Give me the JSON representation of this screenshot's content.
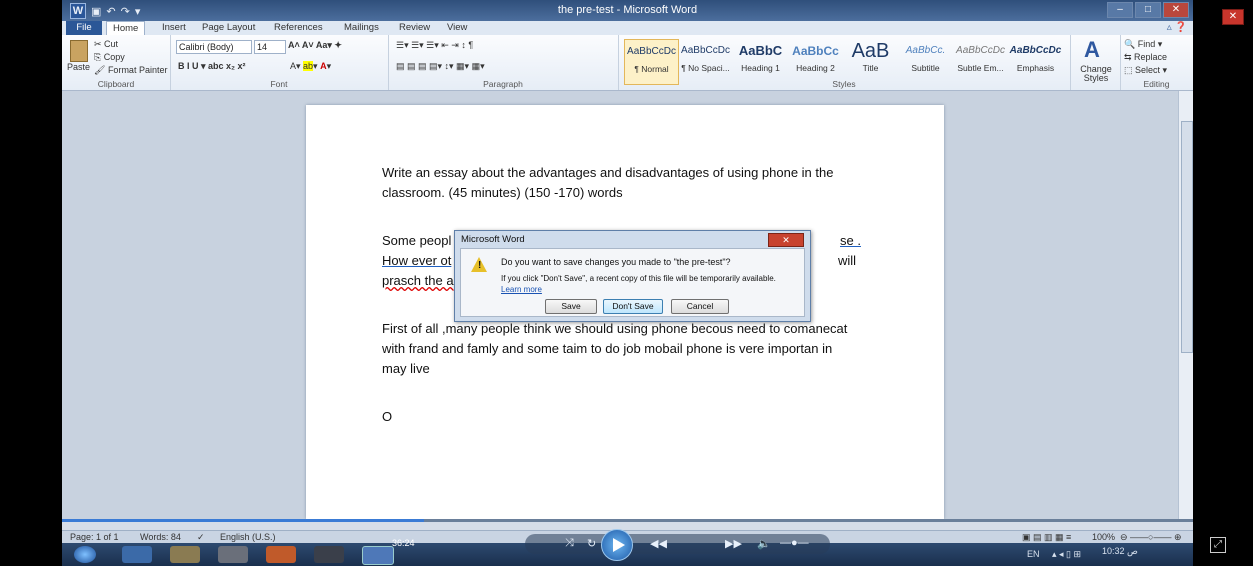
{
  "window": {
    "title": "the pre-test - Microsoft Word",
    "logo": "W"
  },
  "tabs": [
    "File",
    "Home",
    "Insert",
    "Page Layout",
    "References",
    "Mailings",
    "Review",
    "View"
  ],
  "clipboard": {
    "paste": "Paste",
    "cut": "Cut",
    "copy": "Copy",
    "format_painter": "Format Painter",
    "label": "Clipboard"
  },
  "font": {
    "family": "Calibri (Body)",
    "size": "14",
    "label": "Font"
  },
  "paragraph": {
    "label": "Paragraph"
  },
  "styles": {
    "label": "Styles",
    "items": [
      {
        "sample": "AaBbCcDc",
        "name": "¶ Normal"
      },
      {
        "sample": "AaBbCcDc",
        "name": "¶ No Spaci..."
      },
      {
        "sample": "AaBbC",
        "name": "Heading 1"
      },
      {
        "sample": "AaBbCc",
        "name": "Heading 2"
      },
      {
        "sample": "AaB",
        "name": "Title"
      },
      {
        "sample": "AaBbCc.",
        "name": "Subtitle"
      },
      {
        "sample": "AaBbCcDc",
        "name": "Subtle Em..."
      },
      {
        "sample": "AaBbCcDc",
        "name": "Emphasis"
      }
    ],
    "change": "Change Styles"
  },
  "editing": {
    "find": "Find",
    "replace": "Replace",
    "select": "Select",
    "label": "Editing"
  },
  "document": {
    "prompt_line1": "Write an essay about the advantages and disadvantages of using phone in the",
    "prompt_line2": "classroom. (45 minutes) (150 -170) words",
    "p2_line1_start": "Some peopl",
    "p2_line1_end": "se .",
    "p2_line2_start": "How ever ot",
    "p2_line2_end": "will",
    "p2_line3_start": "prasch the a",
    "p3_line1": "First of all ,many people think we should using phone becous need to comanecat",
    "p3_line2": "with frand and famly and some taim to do job mobail phone is vere importan in",
    "p3_line3": "may live",
    "p4": "O"
  },
  "dialog": {
    "title": "Microsoft Word",
    "question": "Do you want to save changes you made to \"the pre-test\"?",
    "info": "If you click \"Don't Save\", a recent copy of this file will be temporarily available.",
    "link": "Learn more",
    "save": "Save",
    "dont_save": "Don't Save",
    "cancel": "Cancel"
  },
  "status": {
    "page": "Page: 1 of 1",
    "words": "Words: 84",
    "language": "English (U.S.)",
    "zoom": "100%"
  },
  "player": {
    "time": "36:24",
    "progress_fraction": 0.32
  },
  "tray": {
    "lang": "EN",
    "time": "10:32 ص"
  }
}
